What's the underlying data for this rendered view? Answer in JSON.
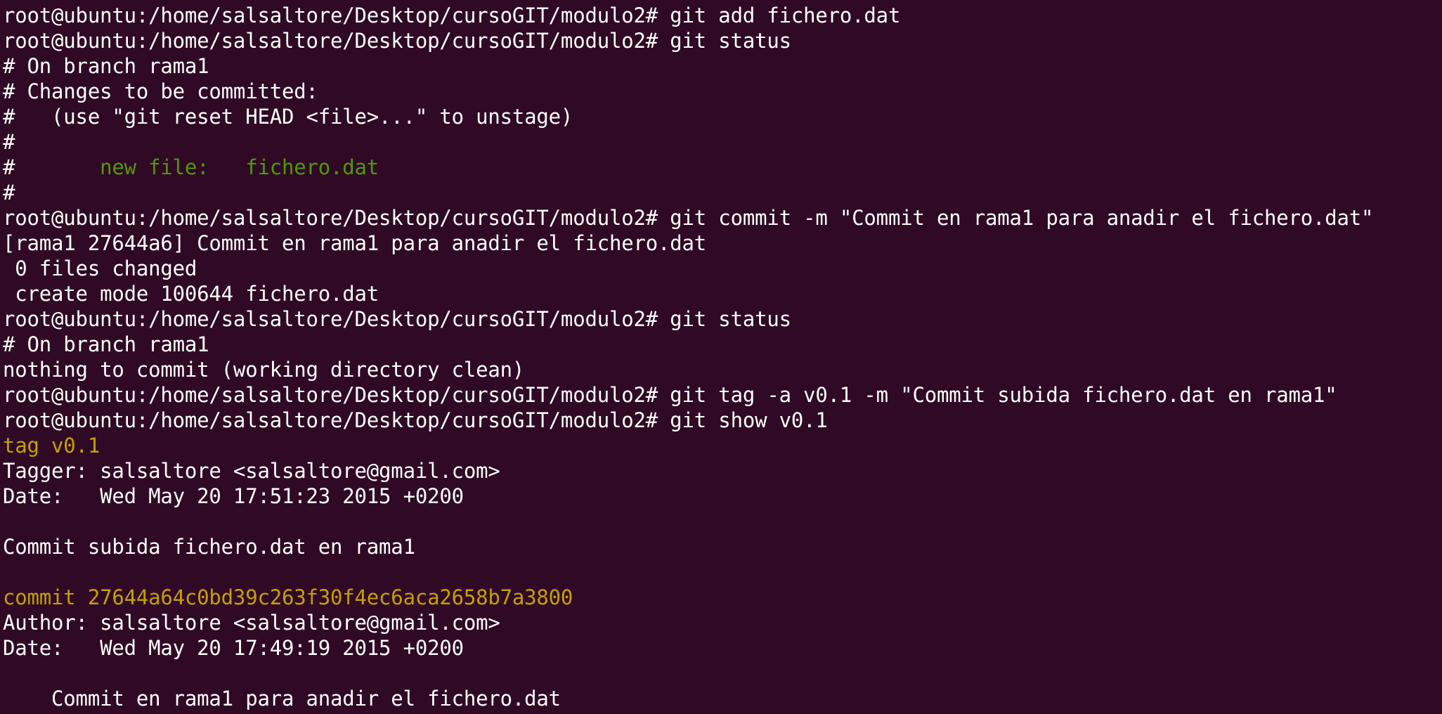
{
  "colors": {
    "background": "#300a24",
    "text": "#ffffff",
    "green": "#4e9a06",
    "yellow": "#c4a000"
  },
  "terminal": {
    "lines": [
      [
        {
          "text": "root@ubuntu:/home/salsaltore/Desktop/cursoGIT/modulo2# git add fichero.dat",
          "color": "#ffffff"
        }
      ],
      [
        {
          "text": "root@ubuntu:/home/salsaltore/Desktop/cursoGIT/modulo2# git status",
          "color": "#ffffff"
        }
      ],
      [
        {
          "text": "# On branch rama1",
          "color": "#ffffff"
        }
      ],
      [
        {
          "text": "# Changes to be committed:",
          "color": "#ffffff"
        }
      ],
      [
        {
          "text": "#   (use \"git reset HEAD <file>...\" to unstage)",
          "color": "#ffffff"
        }
      ],
      [
        {
          "text": "#",
          "color": "#ffffff"
        }
      ],
      [
        {
          "text": "#\t",
          "color": "#ffffff"
        },
        {
          "text": "new file:   fichero.dat",
          "color": "#4e9a06"
        }
      ],
      [
        {
          "text": "#",
          "color": "#ffffff"
        }
      ],
      [
        {
          "text": "root@ubuntu:/home/salsaltore/Desktop/cursoGIT/modulo2# git commit -m \"Commit en rama1 para anadir el fichero.dat\"",
          "color": "#ffffff"
        }
      ],
      [
        {
          "text": "[rama1 27644a6] Commit en rama1 para anadir el fichero.dat",
          "color": "#ffffff"
        }
      ],
      [
        {
          "text": " 0 files changed",
          "color": "#ffffff"
        }
      ],
      [
        {
          "text": " create mode 100644 fichero.dat",
          "color": "#ffffff"
        }
      ],
      [
        {
          "text": "root@ubuntu:/home/salsaltore/Desktop/cursoGIT/modulo2# git status",
          "color": "#ffffff"
        }
      ],
      [
        {
          "text": "# On branch rama1",
          "color": "#ffffff"
        }
      ],
      [
        {
          "text": "nothing to commit (working directory clean)",
          "color": "#ffffff"
        }
      ],
      [
        {
          "text": "root@ubuntu:/home/salsaltore/Desktop/cursoGIT/modulo2# git tag -a v0.1 -m \"Commit subida fichero.dat en rama1\"",
          "color": "#ffffff"
        }
      ],
      [
        {
          "text": "root@ubuntu:/home/salsaltore/Desktop/cursoGIT/modulo2# git show v0.1",
          "color": "#ffffff"
        }
      ],
      [
        {
          "text": "tag v0.1",
          "color": "#c4a000"
        }
      ],
      [
        {
          "text": "Tagger: salsaltore <salsaltore@gmail.com>",
          "color": "#ffffff"
        }
      ],
      [
        {
          "text": "Date:   Wed May 20 17:51:23 2015 +0200",
          "color": "#ffffff"
        }
      ],
      [
        {
          "text": "",
          "color": "#ffffff"
        }
      ],
      [
        {
          "text": "Commit subida fichero.dat en rama1",
          "color": "#ffffff"
        }
      ],
      [
        {
          "text": "",
          "color": "#ffffff"
        }
      ],
      [
        {
          "text": "commit 27644a64c0bd39c263f30f4ec6aca2658b7a3800",
          "color": "#c4a000"
        }
      ],
      [
        {
          "text": "Author: salsaltore <salsaltore@gmail.com>",
          "color": "#ffffff"
        }
      ],
      [
        {
          "text": "Date:   Wed May 20 17:49:19 2015 +0200",
          "color": "#ffffff"
        }
      ],
      [
        {
          "text": "",
          "color": "#ffffff"
        }
      ],
      [
        {
          "text": "    Commit en rama1 para anadir el fichero.dat",
          "color": "#ffffff"
        }
      ]
    ]
  }
}
